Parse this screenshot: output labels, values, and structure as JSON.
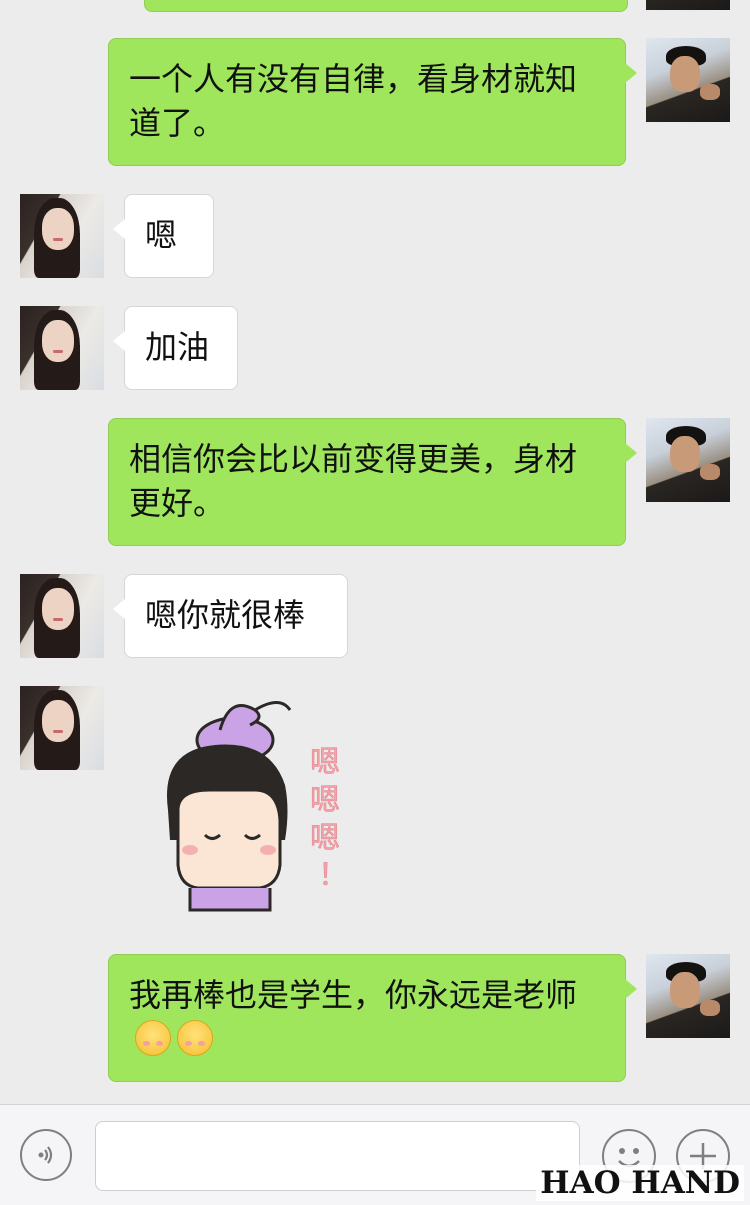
{
  "messages": [
    {
      "side": "right",
      "text": "一个人有没有自律，看身材就知道了。"
    },
    {
      "side": "left",
      "text": "嗯"
    },
    {
      "side": "left",
      "text": "加油"
    },
    {
      "side": "right",
      "text": "相信你会比以前变得更美，身材更好。"
    },
    {
      "side": "left",
      "text": "嗯你就很棒"
    },
    {
      "side": "left",
      "type": "sticker",
      "sticker_text": "嗯嗯嗯！"
    },
    {
      "side": "right",
      "text": "我再棒也是学生，你永远是老师",
      "trailing_emoji": [
        "smiling-blush-emoji",
        "smiling-blush-emoji"
      ]
    }
  ],
  "toolbar": {
    "voice_icon": "voice-icon",
    "input_value": "",
    "emoji_icon": "emoji-icon",
    "plus_icon": "plus-icon"
  },
  "watermark": "HAO HAND",
  "colors": {
    "background": "#ececec",
    "sent_bubble": "#9fe65d",
    "received_bubble": "#ffffff",
    "sticker_hair": "#2b2826",
    "sticker_bun": "#c9a3e6",
    "sticker_text": "#f2a2a8"
  }
}
